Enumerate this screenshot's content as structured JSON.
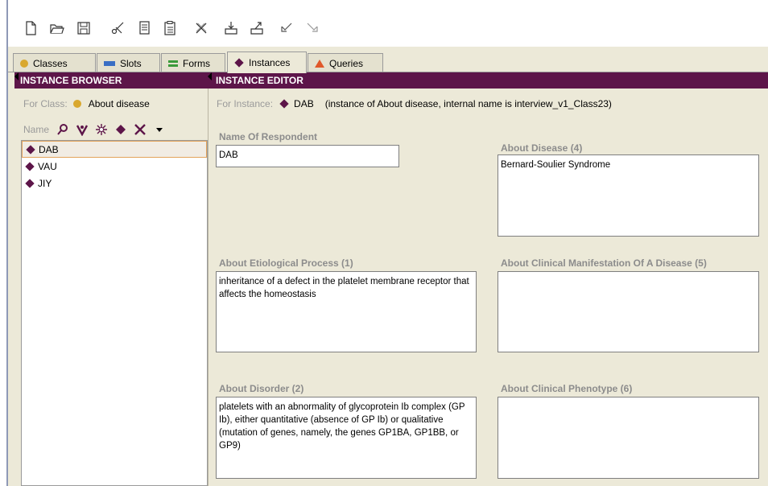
{
  "toolbar": {
    "buttons": [
      {
        "name": "new-project-icon"
      },
      {
        "name": "open-project-icon"
      },
      {
        "name": "save-project-icon"
      },
      {
        "name": "cut-icon"
      },
      {
        "name": "copy-icon"
      },
      {
        "name": "paste-icon"
      },
      {
        "name": "delete-icon"
      },
      {
        "name": "import-icon"
      },
      {
        "name": "export-icon"
      },
      {
        "name": "undo-icon"
      },
      {
        "name": "redo-icon"
      }
    ]
  },
  "tabs": [
    {
      "label": "Classes",
      "icon": "class-circle-icon",
      "color": "#d9a82e"
    },
    {
      "label": "Slots",
      "icon": "slot-bar-icon",
      "color": "#3a6fc4"
    },
    {
      "label": "Forms",
      "icon": "form-lines-icon",
      "color": "#3a9a3a"
    },
    {
      "label": "Instances",
      "icon": "instance-diamond-icon",
      "color": "#5d1549",
      "active": true
    },
    {
      "label": "Queries",
      "icon": "query-triangle-icon",
      "color": "#e0582a"
    }
  ],
  "browser": {
    "header": "INSTANCE BROWSER",
    "for_class_label": "For Class:",
    "for_class_value": "About disease",
    "name_label": "Name",
    "instances": [
      {
        "label": "DAB",
        "selected": true
      },
      {
        "label": "VAU"
      },
      {
        "label": "JIY"
      }
    ]
  },
  "editor": {
    "header": "INSTANCE EDITOR",
    "for_instance_label": "For Instance:",
    "for_instance_value": "DAB",
    "for_instance_extra": "(instance of About disease, internal name is interview_v1_Class23)",
    "slots": {
      "name_of_respondent": {
        "label": "Name Of Respondent",
        "value": "DAB"
      },
      "about_disease": {
        "label": "About Disease (4)",
        "value": "Bernard-Soulier Syndrome"
      },
      "about_etiological": {
        "label": "About Etiological Process (1)",
        "value": "inheritance of a defect in the platelet membrane receptor that affects the homeostasis"
      },
      "about_clinical_manifestation": {
        "label": "About Clinical Manifestation Of A Disease (5)",
        "value": ""
      },
      "about_disorder": {
        "label": "About Disorder (2)",
        "value": "platelets with an abnormality of glycoprotein Ib complex (GP Ib), either quantitative (absence of GP Ib) or qualitative (mutation of genes, namely, the genes GP1BA, GP1BB, or GP9)"
      },
      "about_clinical_phenotype": {
        "label": "About Clinical Phenotype (6)",
        "value": ""
      }
    }
  },
  "colors": {
    "header_bg": "#5d1549",
    "instance_diamond": "#5d1549",
    "class_dot": "#d9a82e",
    "selection_border": "#e3a35b"
  }
}
